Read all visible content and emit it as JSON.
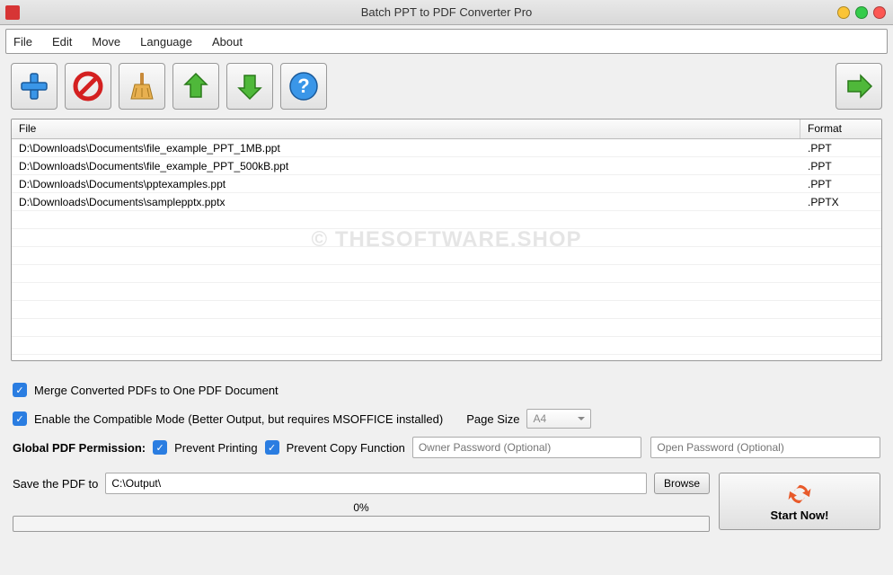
{
  "window": {
    "title": "Batch PPT to PDF Converter Pro"
  },
  "menu": {
    "file": "File",
    "edit": "Edit",
    "move": "Move",
    "language": "Language",
    "about": "About"
  },
  "toolbar": {
    "add": "add",
    "remove": "remove",
    "clear": "clear",
    "moveUp": "move-up",
    "moveDown": "move-down",
    "help": "help",
    "go": "go"
  },
  "table": {
    "headers": {
      "file": "File",
      "format": "Format"
    },
    "rows": [
      {
        "file": "D:\\Downloads\\Documents\\file_example_PPT_1MB.ppt",
        "format": ".PPT"
      },
      {
        "file": "D:\\Downloads\\Documents\\file_example_PPT_500kB.ppt",
        "format": ".PPT"
      },
      {
        "file": "D:\\Downloads\\Documents\\pptexamples.ppt",
        "format": ".PPT"
      },
      {
        "file": "D:\\Downloads\\Documents\\samplepptx.pptx",
        "format": ".PPTX"
      }
    ]
  },
  "watermark": "© THESOFTWARE.SHOP",
  "options": {
    "merge_label": "Merge Converted PDFs to One PDF Document",
    "compat_label": "Enable the Compatible Mode (Better Output, but requires MSOFFICE installed)",
    "page_size_label": "Page Size",
    "page_size_value": "A4",
    "permission_label": "Global PDF Permission:",
    "prevent_print": "Prevent Printing",
    "prevent_copy": "Prevent Copy Function",
    "owner_pwd_placeholder": "Owner Password (Optional)",
    "open_pwd_placeholder": "Open Password (Optional)"
  },
  "save": {
    "label": "Save the PDF to",
    "path": "C:\\Output\\",
    "browse": "Browse"
  },
  "progress": {
    "text": "0%"
  },
  "start": {
    "label": "Start Now!"
  }
}
